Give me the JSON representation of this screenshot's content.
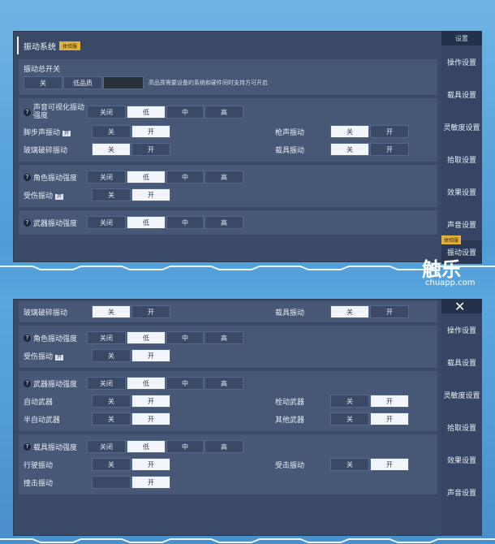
{
  "top": {
    "title": "振动系统",
    "title_badge": "体验服",
    "master": {
      "label": "振动总开关",
      "off": "关",
      "low_quality": "低品质",
      "note": "高品质需要设备的系统和硬件同时支持方可开启"
    },
    "sound_visual": {
      "label": "声音可视化振动强度",
      "options": [
        "关闭",
        "低",
        "中",
        "高"
      ]
    },
    "footstep": {
      "label": "脚步声振动",
      "tag": "开",
      "off": "关",
      "on": "开"
    },
    "gunshot": {
      "label": "枪声振动",
      "off": "关",
      "on": "开"
    },
    "glass": {
      "label": "玻璃破碎振动",
      "off": "关",
      "on": "开"
    },
    "vehicle": {
      "label": "载具振动",
      "off": "关",
      "on": "开"
    },
    "character": {
      "label": "角色振动强度",
      "options": [
        "关闭",
        "低",
        "中",
        "高"
      ]
    },
    "injured": {
      "label": "受伤振动",
      "tag": "开",
      "off": "关",
      "on": "开"
    },
    "weapon": {
      "label": "武器振动强度",
      "options": [
        "关闭",
        "低",
        "中",
        "高"
      ]
    }
  },
  "bottom": {
    "glass": {
      "label": "玻璃破碎振动",
      "off": "关",
      "on": "开"
    },
    "vehicle": {
      "label": "载具振动",
      "off": "关",
      "on": "开"
    },
    "character": {
      "label": "角色振动强度",
      "options": [
        "关闭",
        "低",
        "中",
        "高"
      ]
    },
    "injured": {
      "label": "受伤振动",
      "tag": "开",
      "off": "关",
      "on": "开"
    },
    "weapon": {
      "label": "武器振动强度",
      "options": [
        "关闭",
        "低",
        "中",
        "高"
      ]
    },
    "auto_weapon": {
      "label": "自动武器",
      "off": "关",
      "on": "开"
    },
    "bolt_weapon": {
      "label": "栓动武器",
      "off": "关",
      "on": "开"
    },
    "semi_auto": {
      "label": "半自动武器",
      "off": "关",
      "on": "开"
    },
    "other_weapon": {
      "label": "其他武器",
      "off": "关",
      "on": "开"
    },
    "vehicle_strength": {
      "label": "载具振动强度",
      "options": [
        "关闭",
        "低",
        "中",
        "高"
      ]
    },
    "driving": {
      "label": "行驶振动",
      "off": "关",
      "on": "开"
    },
    "hit": {
      "label": "受击振动",
      "off": "关",
      "on": "开"
    },
    "collision": {
      "label": "撞击振动",
      "on": "开"
    }
  },
  "sidebar_top": {
    "header": "设置",
    "items": [
      "操作设置",
      "载具设置",
      "灵敏度设置",
      "拾取设置",
      "效果设置",
      "声音设置",
      "振动设置"
    ],
    "badge": "体验服"
  },
  "sidebar_bottom": {
    "items": [
      "操作设置",
      "载具设置",
      "灵敏度设置",
      "拾取设置",
      "效果设置",
      "声音设置"
    ]
  },
  "watermark": {
    "main": "触乐",
    "sub": "chuapp.com"
  }
}
